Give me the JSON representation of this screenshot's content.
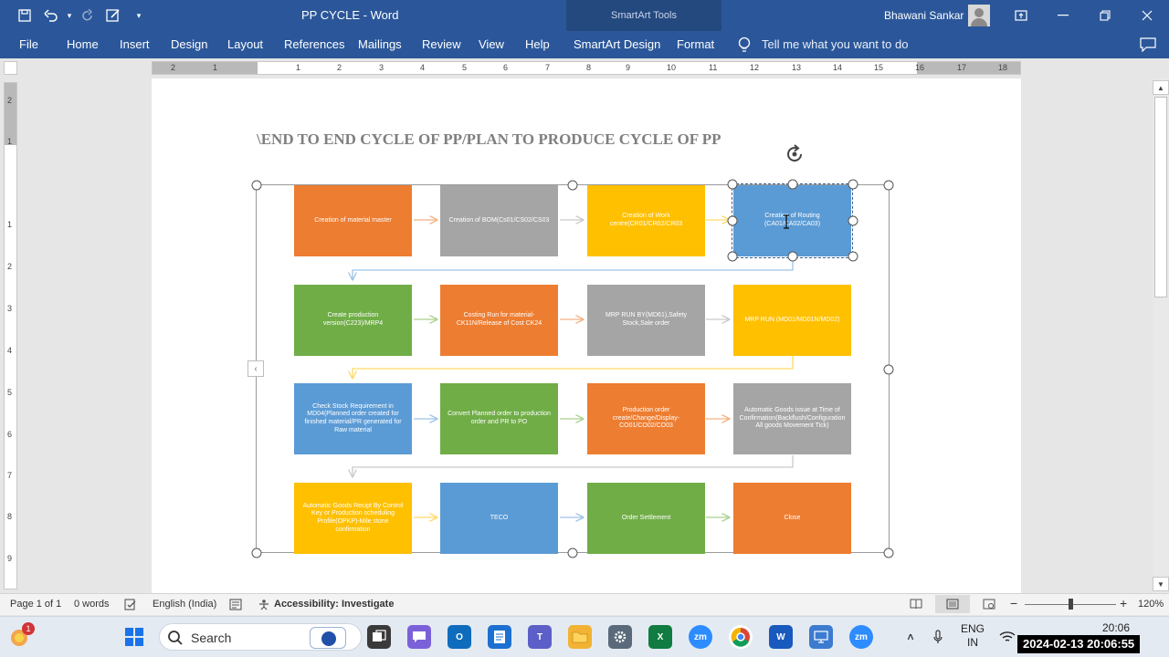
{
  "window": {
    "doc_title": "PP CYCLE  -  Word",
    "contextual_tools": "SmartArt Tools",
    "user_name": "Bhawani Sankar"
  },
  "ribbon": {
    "tabs": [
      "File",
      "Home",
      "Insert",
      "Design",
      "Layout",
      "References",
      "Mailings",
      "Review",
      "View",
      "Help",
      "SmartArt Design",
      "Format"
    ],
    "tell_me": "Tell me what you want to do"
  },
  "ruler": {
    "horizontal_numbers": [
      "2",
      "1",
      "1",
      "2",
      "3",
      "4",
      "5",
      "6",
      "7",
      "8",
      "9",
      "10",
      "11",
      "12",
      "13",
      "14",
      "15",
      "16",
      "17",
      "18"
    ],
    "vertical_numbers": [
      "2",
      "1",
      "1",
      "2",
      "3",
      "4",
      "5",
      "6",
      "7",
      "8",
      "9"
    ]
  },
  "document": {
    "heading": "\\END TO END CYCLE OF PP/PLAN TO PRODUCE CYCLE OF PP",
    "steps": [
      {
        "text": "Creation of material master",
        "color": "#ed7d31"
      },
      {
        "text": "Creation of BOM(Cs01/CS02/CS03",
        "color": "#a5a5a5"
      },
      {
        "text": "Creation of Work centre(CR01/CR02/CR03",
        "color": "#ffc000"
      },
      {
        "text": "Creation of Routing (CA01/CA02/CA03)",
        "color": "#5b9bd5"
      },
      {
        "text": "Create production version(C223)/MRP4",
        "color": "#70ad47"
      },
      {
        "text": "Costing Run for material-CK11N/Release of Cost CK24",
        "color": "#ed7d31"
      },
      {
        "text": "MRP RUN BY(MD61),Safety Stock,Sale order",
        "color": "#a5a5a5"
      },
      {
        "text": "MRP RUN (MD01/MD01N/MD02)",
        "color": "#ffc000"
      },
      {
        "text": "Check Stock Requirement in MD04(Planned order created for finished material/PR generated for Raw material",
        "color": "#5b9bd5"
      },
      {
        "text": "Convert Planned order to production order and PR to PO",
        "color": "#70ad47"
      },
      {
        "text": "Production order create/Change/Display-CO01/CO02/CO03",
        "color": "#ed7d31"
      },
      {
        "text": "Automatic Goods issue at Time of Confirmation(Backflush/Configuration All goods Movement Tick)",
        "color": "#a5a5a5"
      },
      {
        "text": "Automatic Goods Recipt By Control Key or Production scheduling Profile(OPKP)-Mile stone confirmation",
        "color": "#ffc000"
      },
      {
        "text": "TECO",
        "color": "#5b9bd5"
      },
      {
        "text": "Order Settlement",
        "color": "#70ad47"
      },
      {
        "text": "Close",
        "color": "#ed7d31"
      }
    ]
  },
  "statusbar": {
    "page": "Page 1 of 1",
    "words": "0 words",
    "language": "English (India)",
    "accessibility": "Accessibility: Investigate",
    "zoom": "120%"
  },
  "taskbar": {
    "search_label": "Search",
    "lang_line1": "ENG",
    "lang_line2": "IN",
    "clock_time": "20:06",
    "notification_count": "1",
    "timestamp_overlay": "2024-02-13 20:06:55"
  }
}
